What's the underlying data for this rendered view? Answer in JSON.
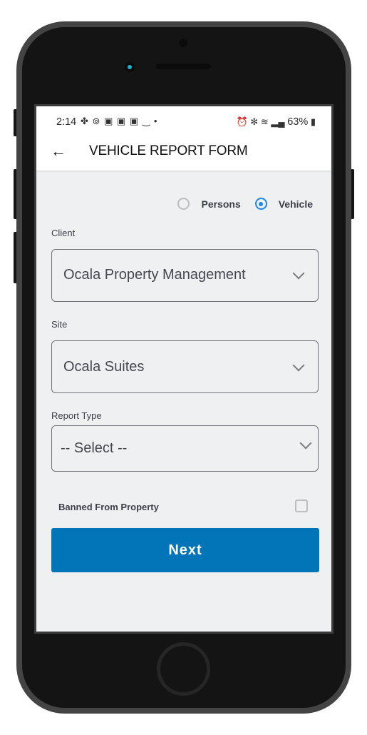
{
  "status_bar": {
    "time": "2:14",
    "left_icons": [
      "pinwheel-icon",
      "link-icon",
      "app-icon",
      "app-icon",
      "app-icon",
      "smile-icon",
      "dot-icon"
    ],
    "right_icons": [
      "alarm-icon",
      "bluetooth-icon",
      "wifi-icon",
      "signal-icon"
    ],
    "battery": "63%"
  },
  "app_bar": {
    "back_icon": "arrow-left-icon",
    "title": "VEHICLE REPORT FORM"
  },
  "mode_radio": {
    "options": [
      {
        "label": "Persons",
        "checked": false
      },
      {
        "label": "Vehicle",
        "checked": true
      }
    ]
  },
  "form": {
    "client": {
      "label": "Client",
      "value": "Ocala Property Management"
    },
    "site": {
      "label": "Site",
      "value": "Ocala Suites"
    },
    "report_type": {
      "label": "Report Type",
      "value": "-- Select --"
    },
    "banned": {
      "label": "Banned From Property",
      "checked": false
    },
    "next_label": "Next"
  },
  "colors": {
    "primary": "#0275b8",
    "radio_accent": "#1e88e5",
    "background": "#eff0f2"
  }
}
